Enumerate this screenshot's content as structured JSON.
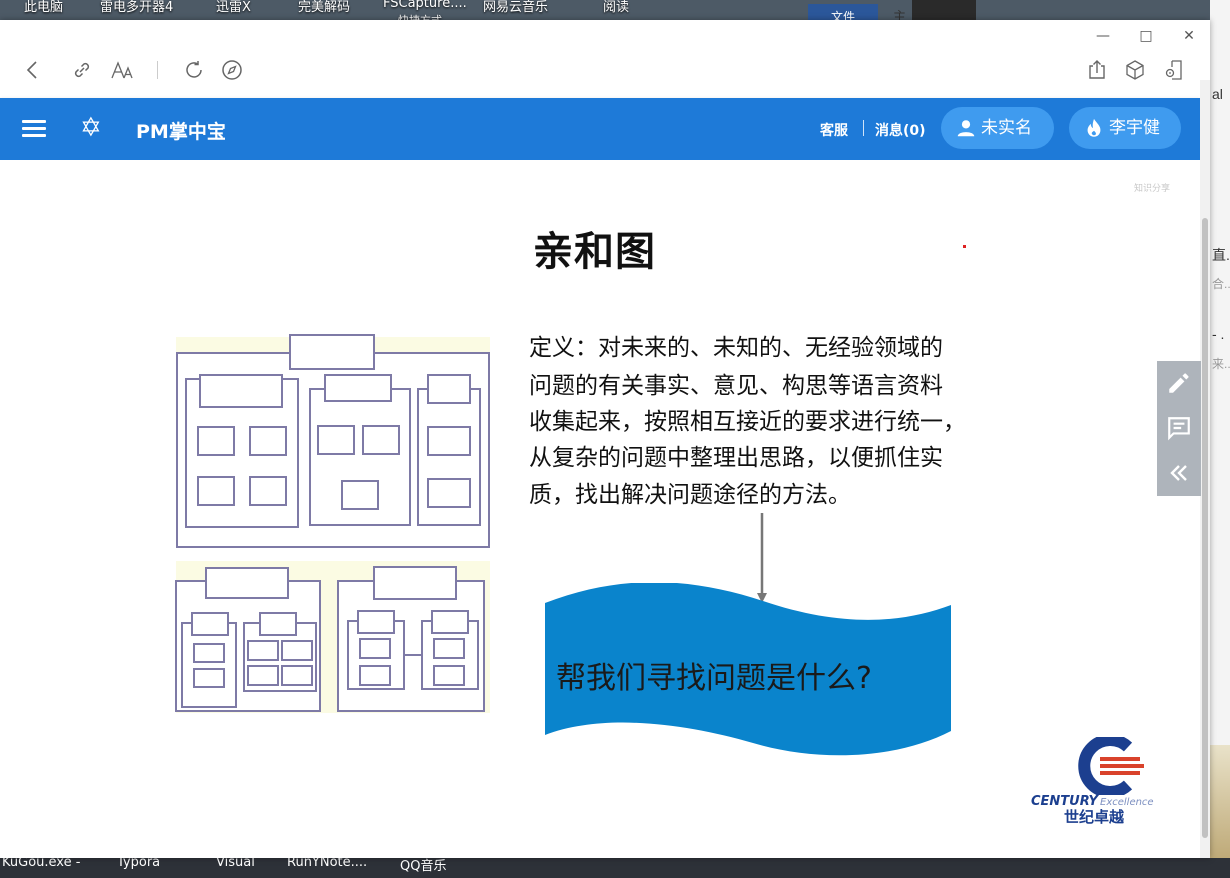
{
  "desktop": {
    "top_items": [
      "此电脑",
      "雷电多开器4",
      "迅雷X",
      "完美解码",
      "FSCapture....",
      "网易云音乐",
      "阅读"
    ],
    "top_sub": "快捷方式",
    "word_tab": "文件",
    "word_tab_next": "主",
    "taskbar_items": [
      "KuGou.exe -",
      "Typora",
      "Visual",
      "RunYNote....",
      "QQ音乐"
    ],
    "side_fragments": [
      "al",
      "直...",
      "合...",
      "- .",
      "来..."
    ]
  },
  "window": {
    "controls": {
      "minimize": "—",
      "maximize": "□",
      "close": "✕"
    },
    "toolbar_icons": [
      "back-icon",
      "link-icon",
      "font-size-icon",
      "refresh-icon",
      "compass-icon",
      "share-icon",
      "cube-icon",
      "screen-note-icon"
    ]
  },
  "app": {
    "title": "PM掌中宝",
    "service": "客服",
    "messages": "消息(0)",
    "verify_btn": "未实名",
    "user_btn": "李宇健",
    "brand_color": "#1e7ad8"
  },
  "slide": {
    "title": "亲和图",
    "definition_lines": [
      "定义：对未来的、未知的、无经验领域的",
      "问题的有关事实、意见、构思等语言资料",
      "收集起来，按照相互接近的要求进行统一，",
      "从复杂的问题中整理出思路，以便抓住实",
      "质，找出解决问题途径的方法。"
    ],
    "banner": "帮我们寻找问题是什么?",
    "watermark": "知识分享",
    "logo_en1": "CENTURY",
    "logo_en2": "Excellence",
    "logo_cn": "世纪卓越",
    "banner_color": "#0a84cc"
  },
  "fab": {
    "icons": [
      "edit-icon",
      "comment-icon",
      "collapse-icon"
    ]
  }
}
